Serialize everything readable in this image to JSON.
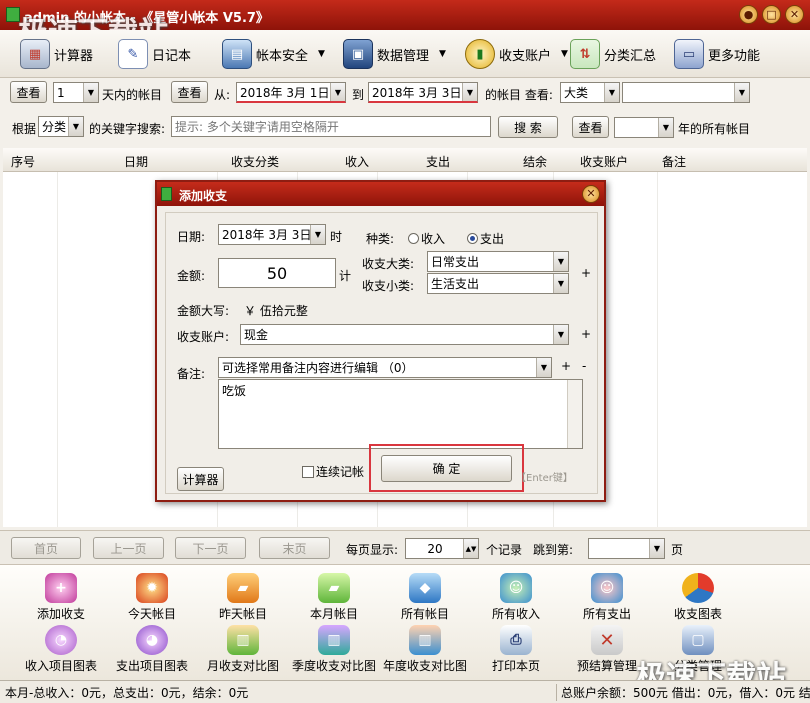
{
  "window": {
    "title": "admin 的小帐本 - 《星管小帐本 V5.7》",
    "watermark": "极速下载站",
    "min_glyph": "●",
    "max_glyph": "□",
    "close_glyph": "✕"
  },
  "toolbar": {
    "items": [
      {
        "label": "计算器",
        "icon": "calculator-icon"
      },
      {
        "label": "日记本",
        "icon": "diary-icon"
      },
      {
        "label": "帐本安全",
        "icon": "account-book-security-icon",
        "dropdown": "▼"
      },
      {
        "label": "数据管理",
        "icon": "data-management-icon",
        "dropdown": "▼"
      },
      {
        "label": "收支账户",
        "icon": "accounts-chart-icon",
        "dropdown": "▼"
      },
      {
        "label": "分类汇总",
        "icon": "category-summary-icon"
      },
      {
        "label": "更多功能",
        "icon": "more-functions-icon"
      }
    ]
  },
  "filter1": {
    "view_btn1": "查看",
    "days_value": "1",
    "days_suffix": "天内的帐目",
    "view_btn2": "查看",
    "from_label": "从:",
    "from_date": "2018年 3月 1日",
    "to_label": "到",
    "to_date": "2018年 3月 3日",
    "range_suffix": "的帐目 查看:",
    "category_value": "大类",
    "subcategory_value": ""
  },
  "filter2": {
    "by_label": "根据",
    "by_value": "分类",
    "keyword_label": "的关键字搜索:",
    "search_placeholder": "提示: 多个关键字请用空格隔开",
    "search_btn": "搜 索",
    "view_btn": "查看",
    "year_value": "",
    "year_suffix": "年的所有帐目"
  },
  "grid": {
    "columns": [
      "序号",
      "日期",
      "收支分类",
      "收入",
      "支出",
      "结余",
      "收支账户",
      "备注"
    ]
  },
  "pager": {
    "first": "首页",
    "prev": "上一页",
    "next": "下一页",
    "last": "末页",
    "per_page_label": "每页显示:",
    "per_page_value": "20",
    "records_label": "个记录",
    "jump_label": "跳到第:",
    "jump_value": "",
    "page_suffix": "页"
  },
  "bottom": {
    "row1": [
      {
        "label": "添加收支",
        "icon": "add-entry-icon"
      },
      {
        "label": "今天帐目",
        "icon": "today-icon"
      },
      {
        "label": "昨天帐目",
        "icon": "yesterday-icon"
      },
      {
        "label": "本月帐目",
        "icon": "this-month-icon"
      },
      {
        "label": "所有帐目",
        "icon": "all-entries-icon"
      },
      {
        "label": "所有收入",
        "icon": "all-income-icon"
      },
      {
        "label": "所有支出",
        "icon": "all-expense-icon"
      },
      {
        "label": "收支图表",
        "icon": "pie-chart-icon"
      }
    ],
    "row2": [
      {
        "label": "收入项目图表",
        "icon": "income-chart-icon"
      },
      {
        "label": "支出项目图表",
        "icon": "expense-chart-icon"
      },
      {
        "label": "月收支对比图",
        "icon": "monthly-compare-icon"
      },
      {
        "label": "季度收支对比图",
        "icon": "quarterly-compare-icon"
      },
      {
        "label": "年度收支对比图",
        "icon": "yearly-compare-icon"
      },
      {
        "label": "打印本页",
        "icon": "print-icon"
      },
      {
        "label": "预结算管理",
        "icon": "pre-settlement-icon"
      },
      {
        "label": "分类管理",
        "icon": "category-management-icon"
      }
    ]
  },
  "status": {
    "left": "本月-总收入：0元，总支出：0元，结余：0元",
    "right": "总账户余额：500元 借出：0元，借入：0元 结"
  },
  "dialog": {
    "title": "添加收支",
    "date_label": "日期:",
    "date_value": "2018年 3月 3日",
    "time_label": "时",
    "type_label": "种类:",
    "income_option": "收入",
    "expense_option": "支出",
    "amount_label": "金额:",
    "amount_value": "50",
    "calc_label": "计",
    "major_cat_label": "收支大类:",
    "major_cat_value": "日常支出",
    "minor_cat_label": "收支小类:",
    "minor_cat_value": "生活支出",
    "uppercase_label": "金额大写:",
    "uppercase_value": "￥ 伍拾元整",
    "account_label": "收支账户:",
    "account_value": "现金",
    "note_label": "备注:",
    "note_select": "可选择常用备注内容进行编辑 （0）",
    "note_text": "吃饭",
    "plus": "+",
    "minus": "-",
    "calc_btn": "计算器",
    "continuous_label": "连续记帐",
    "confirm_btn": "确   定",
    "enter_hint": "【Enter键】"
  },
  "colors": {
    "title_red": "#b4200f",
    "highlight_red": "#d9363e"
  }
}
